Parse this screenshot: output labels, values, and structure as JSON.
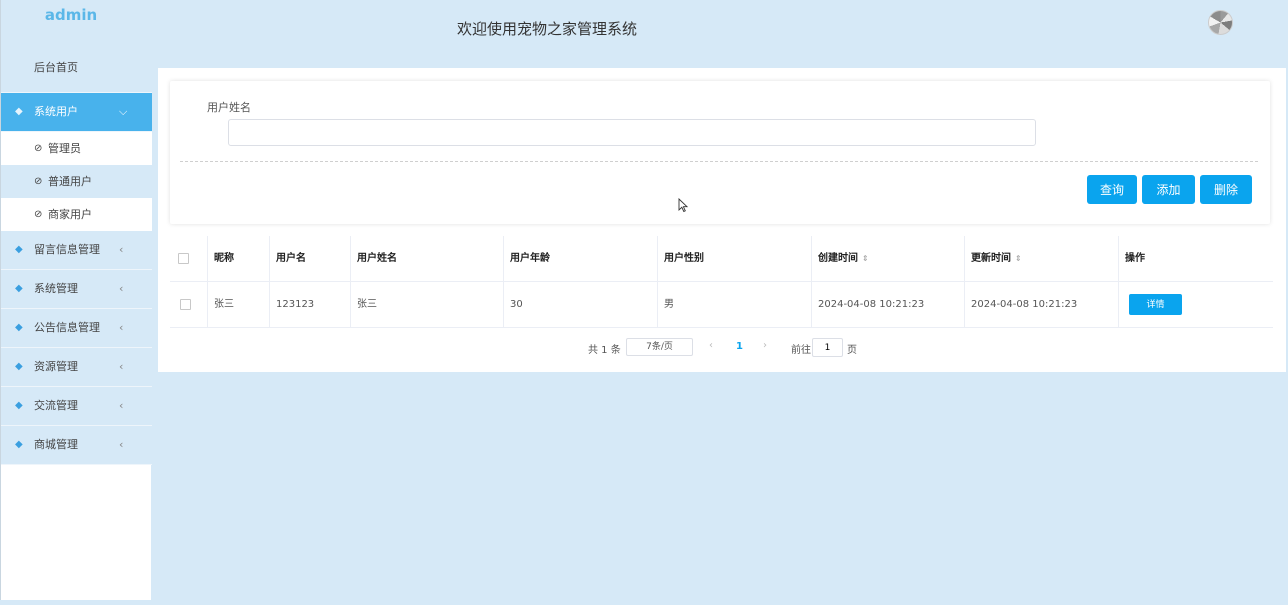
{
  "sidebar": {
    "logo": "admin",
    "home": "后台首页",
    "active_group": {
      "label": "系统用户",
      "arrow": "⌵"
    },
    "sub_items": [
      {
        "label": "管理员"
      },
      {
        "label": "普通用户"
      },
      {
        "label": "商家用户"
      }
    ],
    "groups": [
      {
        "label": "留言信息管理",
        "arrow": "‹"
      },
      {
        "label": "系统管理",
        "arrow": "‹"
      },
      {
        "label": "公告信息管理",
        "arrow": "‹"
      },
      {
        "label": "资源管理",
        "arrow": "‹"
      },
      {
        "label": "交流管理",
        "arrow": "‹"
      },
      {
        "label": "商城管理",
        "arrow": "‹"
      }
    ]
  },
  "header": {
    "title": "欢迎使用宠物之家管理系统"
  },
  "search": {
    "field_label": "用户姓名",
    "field_value": "",
    "buttons": {
      "search": "查询",
      "add": "添加",
      "delete": "删除"
    }
  },
  "table": {
    "headers": [
      "昵称",
      "用户名",
      "用户姓名",
      "用户年龄",
      "用户性别",
      "创建时间",
      "更新时间",
      "操作"
    ],
    "rows": [
      {
        "nickname": "张三",
        "username": "123123",
        "name": "张三",
        "age": "30",
        "gender": "男",
        "created": "2024-04-08 10:21:23",
        "updated": "2024-04-08 10:21:23",
        "action": "详情"
      }
    ]
  },
  "pager": {
    "total": "共 1 条",
    "page_size": "7条/页",
    "current": "1",
    "goto": "前往",
    "goto_value": "1",
    "page_word": "页"
  },
  "icons": {
    "menu": "gem-icon",
    "sub": "check-circle-icon",
    "sort": "sort-icon"
  },
  "colors": {
    "accent": "#0aa4ee",
    "active_menu": "#48b2ec",
    "background": "#d6e9f7"
  }
}
